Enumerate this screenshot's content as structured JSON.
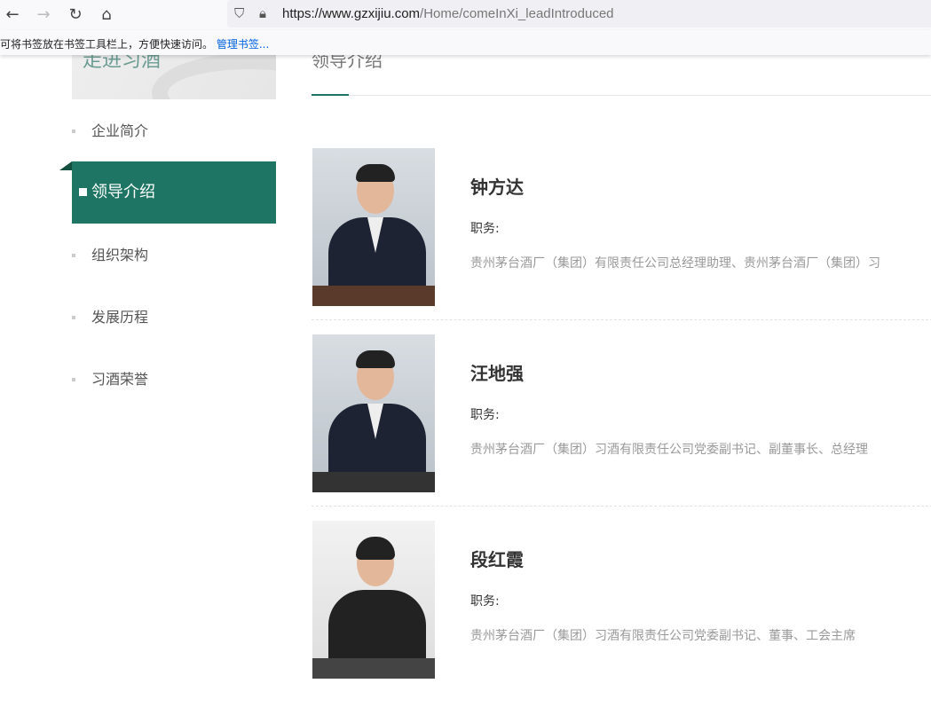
{
  "browser": {
    "url_host": "https://www.gzxijiu.com",
    "url_path": "/Home/comeInXi_leadIntroduced",
    "bookmarks_hint": "可将书签放在书签工具栏上，方便快速访问。",
    "manage_bookmarks": "管理书签..."
  },
  "sidebar": {
    "header": "走进习酒",
    "items": [
      {
        "label": "企业简介"
      },
      {
        "label": "领导介绍"
      },
      {
        "label": "组织架构"
      },
      {
        "label": "发展历程"
      },
      {
        "label": "习酒荣誉"
      }
    ]
  },
  "main": {
    "title": "领导介绍",
    "leaders": [
      {
        "name": "钟方达",
        "role_label": "职务:",
        "role": "贵州茅台酒厂（集团）有限责任公司总经理助理、贵州茅台酒厂（集团）习"
      },
      {
        "name": "汪地强",
        "role_label": "职务:",
        "role": "贵州茅台酒厂（集团）习酒有限责任公司党委副书记、副董事长、总经理"
      },
      {
        "name": "段红霞",
        "role_label": "职务:",
        "role": "贵州茅台酒厂（集团）习酒有限责任公司党委副书记、董事、工会主席"
      }
    ]
  },
  "colors": {
    "accent": "#1e7563"
  }
}
